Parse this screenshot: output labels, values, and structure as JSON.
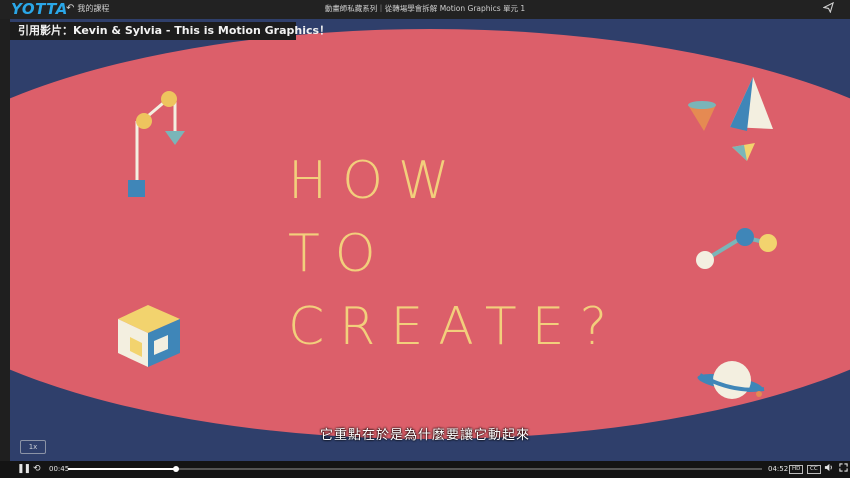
{
  "header": {
    "logo": "YOTTA",
    "back_label": "我的課程",
    "course_title": "動畫師私藏系列｜從轉場學會拆解 Motion Graphics 單元 1",
    "share_icon": "share-icon"
  },
  "video": {
    "quote_label": "引用影片：Kevin & Sylvia - This is Motion Graphics！",
    "headline": [
      "HOW",
      "TO",
      "CREATE?"
    ],
    "subtitle": "它重點在於是為什麼要讓它動起來",
    "speed": "1x",
    "colors": {
      "background": "#2f3f6b",
      "ellipse": "#dc5f6a",
      "headline": "#f2cf7c"
    }
  },
  "player": {
    "current_time": "00:45",
    "total_time": "04:52",
    "progress": 0.155,
    "hd_label": "HD",
    "cc_label": "CC"
  }
}
